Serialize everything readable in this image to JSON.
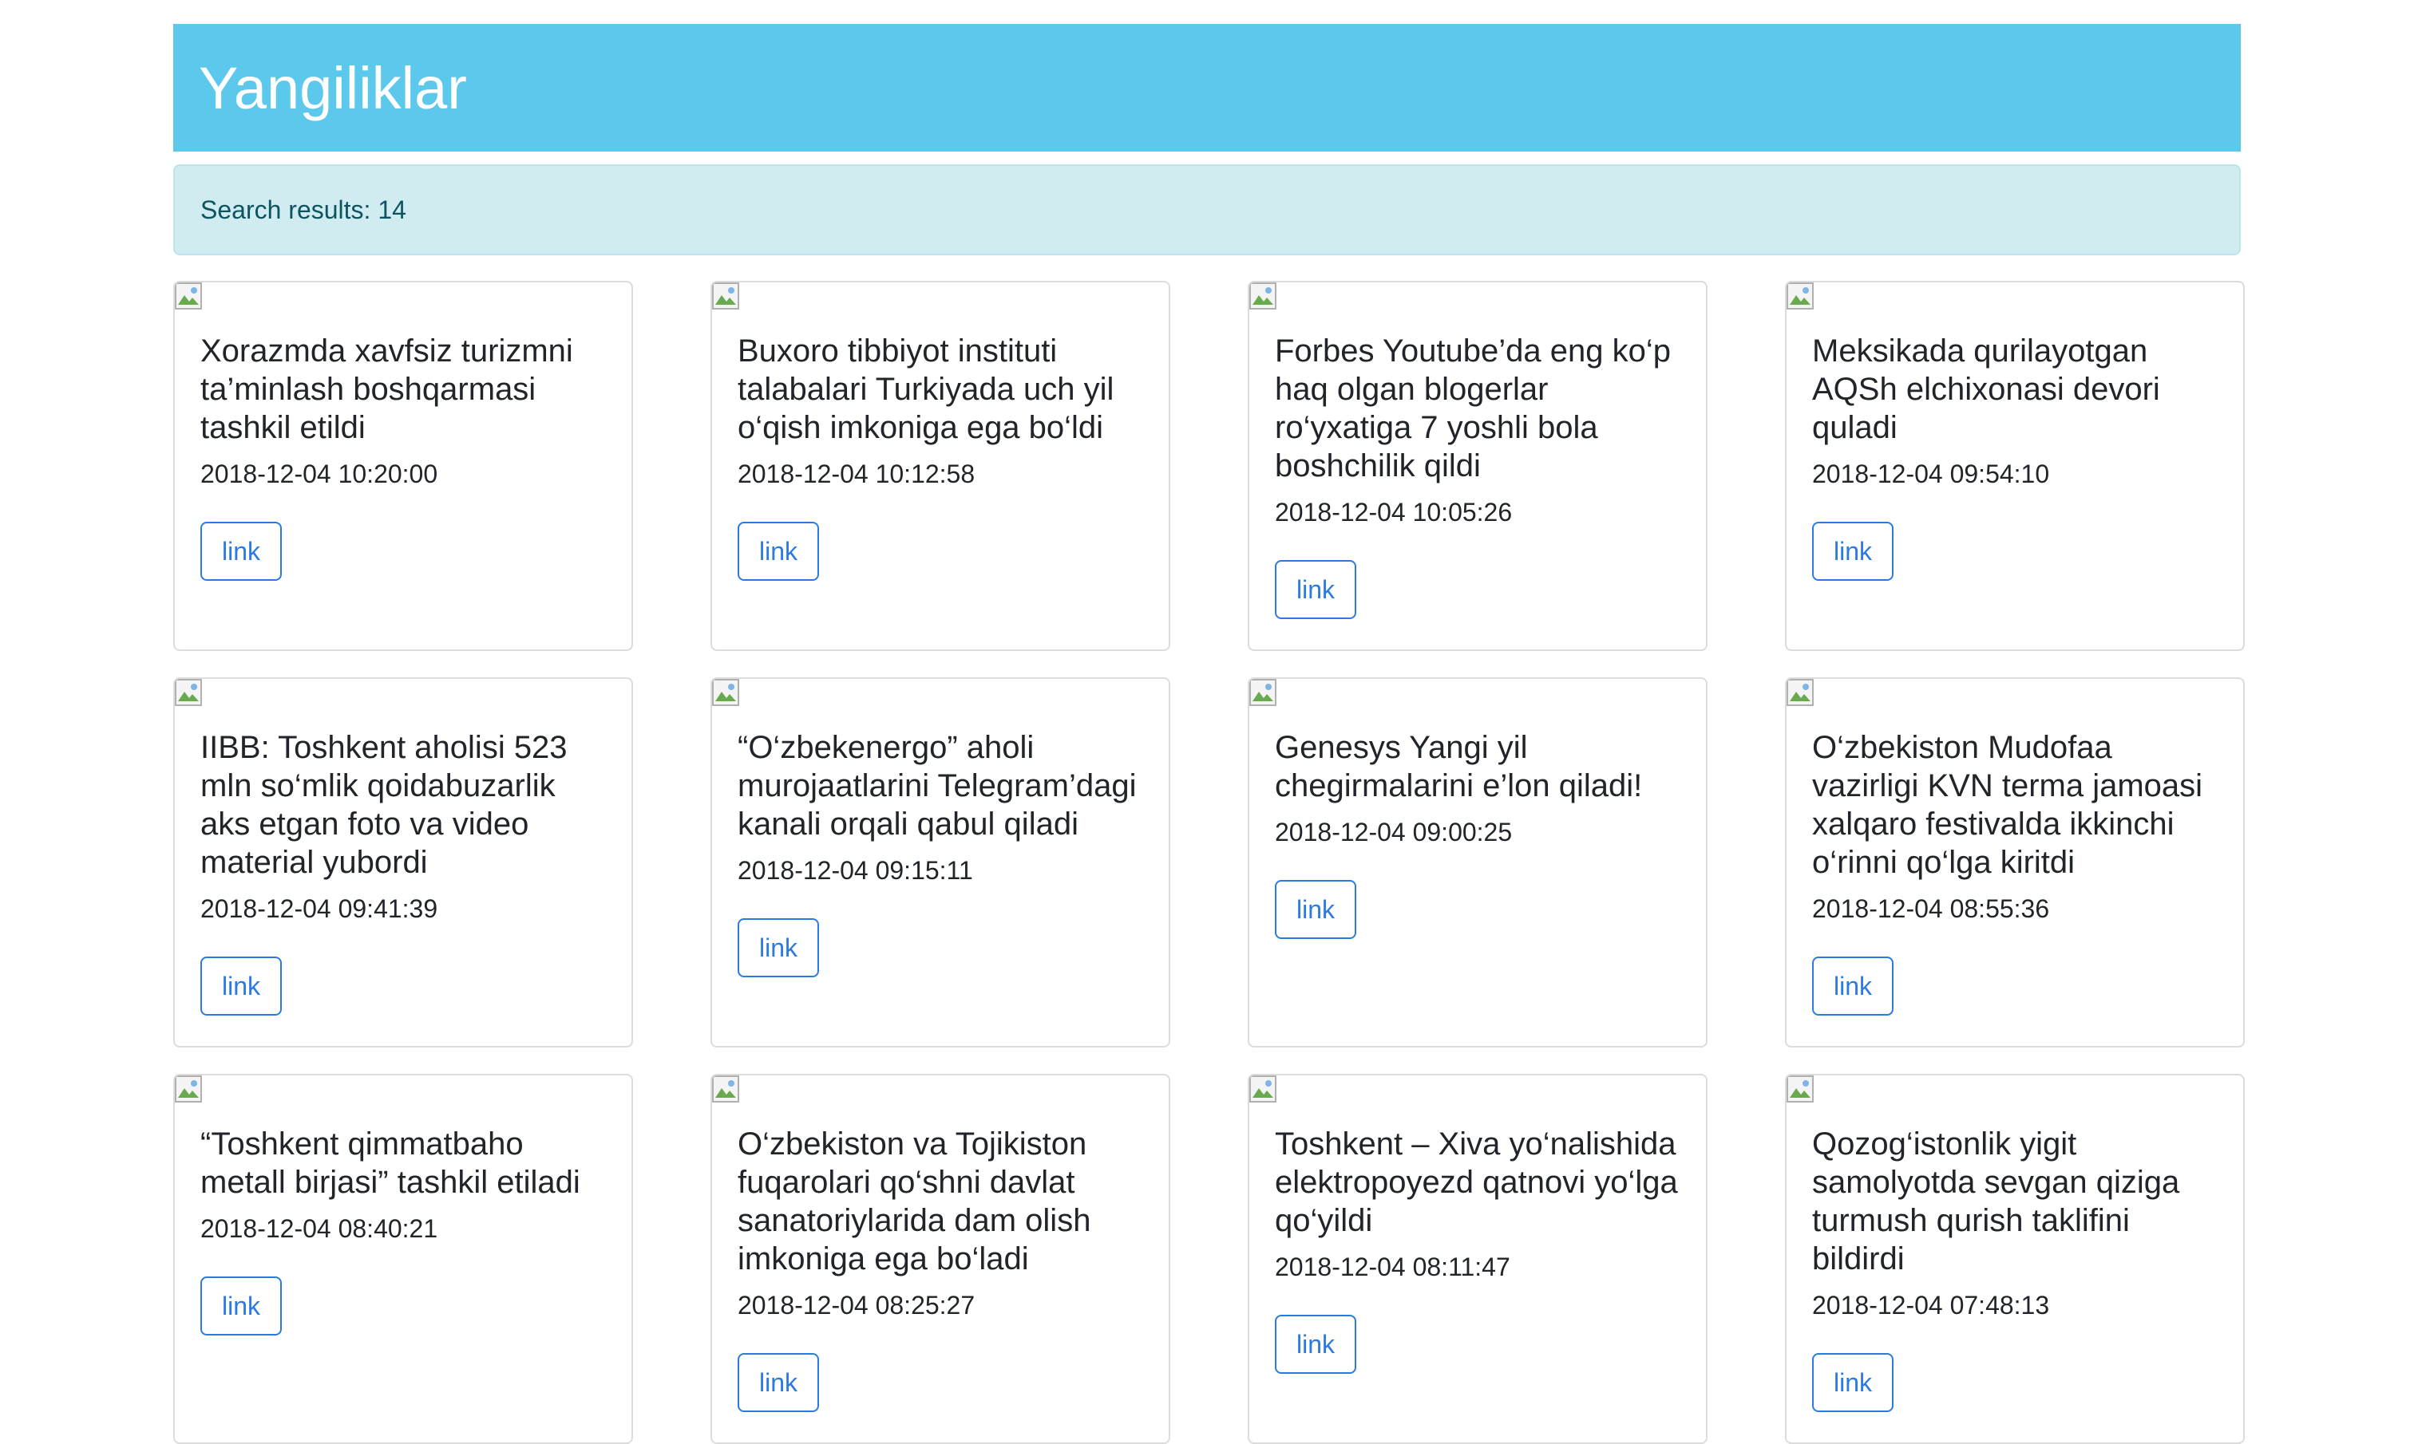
{
  "header": {
    "title": "Yangiliklar"
  },
  "alert": {
    "text": "Search results: 14"
  },
  "colors": {
    "navbar": "#5bc8ec",
    "alert_bg": "#d1ecf1",
    "link": "#2a7ae2"
  },
  "articles": [
    {
      "title": "Xorazmda xavfsiz turizmni ta’minlash boshqarmasi tashkil etildi",
      "date": "2018-12-04 10:20:00",
      "link_label": "link"
    },
    {
      "title": "Buxoro tibbiyot instituti talabalari Turkiyada uch yil o‘qish imkoniga ega bo‘ldi",
      "date": "2018-12-04 10:12:58",
      "link_label": "link"
    },
    {
      "title": "Forbes Youtube’da eng ko‘p haq olgan blogerlar ro‘yxatiga 7 yoshli bola boshchilik qildi",
      "date": "2018-12-04 10:05:26",
      "link_label": "link"
    },
    {
      "title": "Meksikada qurilayotgan AQSh elchixonasi devori quladi",
      "date": "2018-12-04 09:54:10",
      "link_label": "link"
    },
    {
      "title": "IIBB: Toshkent aholisi 523 mln so‘mlik qoidabuzarlik aks etgan foto va video material yubordi",
      "date": "2018-12-04 09:41:39",
      "link_label": "link"
    },
    {
      "title": "“O‘zbekenergo” aholi murojaatlarini Telegram’dagi kanali orqali qabul qiladi",
      "date": "2018-12-04 09:15:11",
      "link_label": "link"
    },
    {
      "title": "Genesys Yangi yil chegirmalarini e’lon qiladi!",
      "date": "2018-12-04 09:00:25",
      "link_label": "link"
    },
    {
      "title": "O‘zbekiston Mudofaa vazirligi KVN terma jamoasi xalqaro festivalda ikkinchi o‘rinni qo‘lga kiritdi",
      "date": "2018-12-04 08:55:36",
      "link_label": "link"
    },
    {
      "title": "“Toshkent qimmatbaho metall birjasi” tashkil etiladi",
      "date": "2018-12-04 08:40:21",
      "link_label": "link"
    },
    {
      "title": "O‘zbekiston va Tojikiston fuqarolari qo‘shni davlat sanatoriylarida dam olish imkoniga ega bo‘ladi",
      "date": "2018-12-04 08:25:27",
      "link_label": "link"
    },
    {
      "title": "Toshkent – Xiva yo‘nalishida elektropoyezd qatnovi yo‘lga qo‘yildi",
      "date": "2018-12-04 08:11:47",
      "link_label": "link"
    },
    {
      "title": "Qozog‘istonlik yigit samolyotda sevgan qiziga turmush qurish taklifini bildirdi",
      "date": "2018-12-04 07:48:13",
      "link_label": "link"
    }
  ]
}
